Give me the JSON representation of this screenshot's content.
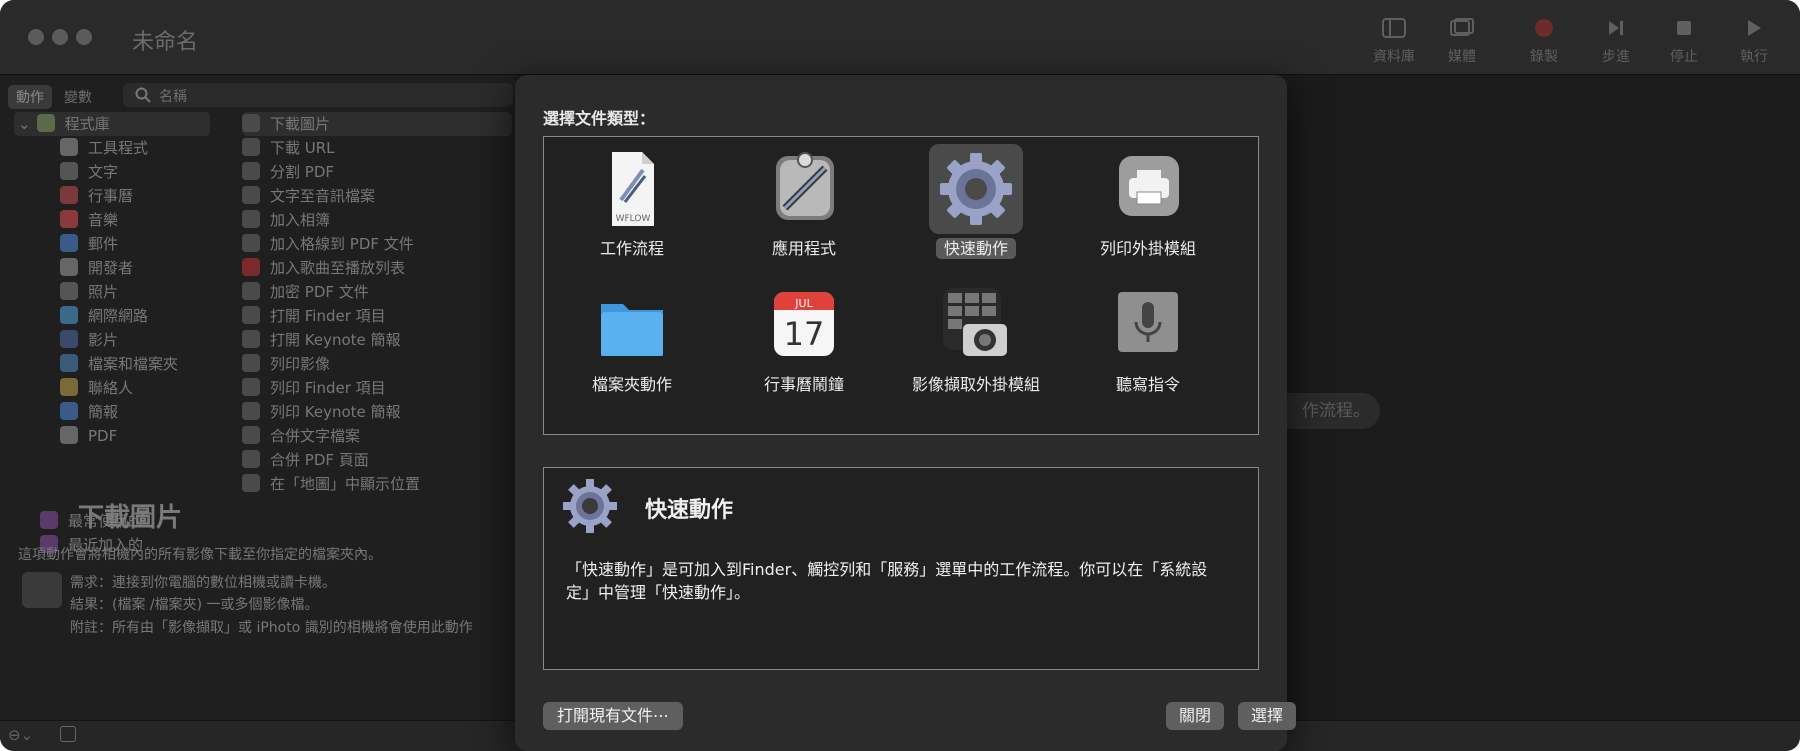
{
  "window": {
    "title": "未命名"
  },
  "toolbar": {
    "library_label": "資料庫",
    "media_label": "媒體",
    "record_label": "錄製",
    "step_label": "步進",
    "stop_label": "停止",
    "run_label": "執行"
  },
  "left_pane": {
    "segment_actions": "動作",
    "segment_variables": "變數",
    "search_placeholder": "名稱",
    "library_header": "程式庫",
    "categories": [
      "工具程式",
      "文字",
      "行事曆",
      "音樂",
      "郵件",
      "開發者",
      "照片",
      "網際網路",
      "影片",
      "檔案和檔案夾",
      "聯絡人",
      "簡報",
      "PDF"
    ],
    "most_used": "最常使用的",
    "recently_added": "最近加入的",
    "actions": [
      "下載圖片",
      "下載 URL",
      "分割 PDF",
      "文字至音訊檔案",
      "加入相簿",
      "加入格線到 PDF 文件",
      "加入歌曲至播放列表",
      "加密 PDF 文件",
      "打開 Finder 項目",
      "打開 Keynote 簡報",
      "列印影像",
      "列印 Finder 項目",
      "列印 Keynote 簡報",
      "合併文字檔案",
      "合併 PDF 頁面",
      "在「地圖」中顯示位置"
    ],
    "calendar_badge": "17"
  },
  "detail": {
    "title": "下載圖片",
    "description": "這項動作會將相機內的所有影像下載至你指定的檔案夾內。",
    "requires": "需求：連接到你電腦的數位相機或讀卡機。",
    "result": "結果：(檔案 /檔案夾) 一或多個影像檔。",
    "note": "附註：所有由「影像擷取」或 iPhoto 識別的相機將會使用此動作"
  },
  "canvas_hint": "作流程。",
  "sheet": {
    "choose_label": "選擇文件類型：",
    "types": [
      {
        "label": "工作流程",
        "icon": "workflow-document-icon",
        "selected": false
      },
      {
        "label": "應用程式",
        "icon": "automator-robot-icon",
        "selected": false
      },
      {
        "label": "快速動作",
        "icon": "gear-icon",
        "selected": true
      },
      {
        "label": "列印外掛模組",
        "icon": "printer-icon",
        "selected": false
      },
      {
        "label": "檔案夾動作",
        "icon": "folder-icon",
        "selected": false
      },
      {
        "label": "行事曆鬧鐘",
        "icon": "calendar-icon",
        "selected": false
      },
      {
        "label": "影像擷取外掛模組",
        "icon": "image-capture-icon",
        "selected": false
      },
      {
        "label": "聽寫指令",
        "icon": "microphone-icon",
        "selected": false
      }
    ],
    "workflow_badge": "WFLOW",
    "calendar_month": "JUL",
    "calendar_day": "17",
    "description_title": "快速動作",
    "description_text": "「快速動作」是可加入到Finder、觸控列和「服務」選單中的工作流程。你可以在「系統設定」中管理「快速動作」。",
    "open_existing": "打開現有文件⋯",
    "close": "關閉",
    "choose": "選擇"
  },
  "colors": {
    "accent_gear": "#9aa3c7",
    "folder_blue": "#5ab1f0",
    "calendar_red": "#e0413a",
    "record_red": "#6e2a2a"
  }
}
